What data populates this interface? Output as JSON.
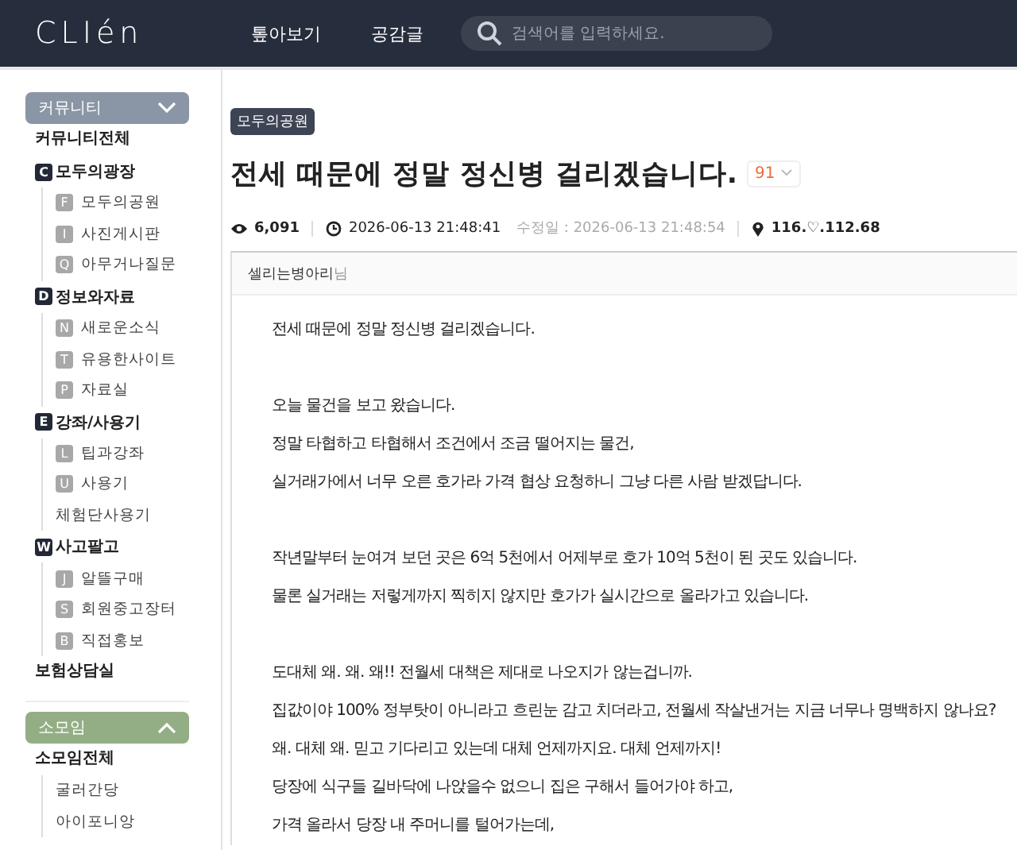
{
  "header": {
    "logo": "CLIén",
    "nav": [
      "톺아보기",
      "공감글"
    ],
    "search": {
      "placeholder": "검색어를 입력하세요."
    }
  },
  "sidebar": {
    "sections": [
      {
        "label": "커뮤니티",
        "expanded": false,
        "color": "#8a96a5",
        "items": [
          {
            "kind": "top",
            "label": "커뮤니티전체"
          },
          {
            "kind": "group",
            "badge": "C",
            "label": "모두의광장",
            "children": [
              {
                "badge": "F",
                "label": "모두의공원"
              },
              {
                "badge": "I",
                "label": "사진게시판"
              },
              {
                "badge": "Q",
                "label": "아무거나질문"
              }
            ]
          },
          {
            "kind": "group",
            "badge": "D",
            "label": "정보와자료",
            "children": [
              {
                "badge": "N",
                "label": "새로운소식"
              },
              {
                "badge": "T",
                "label": "유용한사이트"
              },
              {
                "badge": "P",
                "label": "자료실"
              }
            ]
          },
          {
            "kind": "group",
            "badge": "E",
            "label": "강좌/사용기",
            "children": [
              {
                "badge": "L",
                "label": "팁과강좌"
              },
              {
                "badge": "U",
                "label": "사용기"
              },
              {
                "label": "체험단사용기"
              }
            ]
          },
          {
            "kind": "group",
            "badge": "W",
            "label": "사고팔고",
            "children": [
              {
                "badge": "J",
                "label": "알뜰구매"
              },
              {
                "badge": "S",
                "label": "회원중고장터"
              },
              {
                "badge": "B",
                "label": "직접홍보"
              }
            ]
          },
          {
            "kind": "top",
            "label": "보험상담실"
          }
        ]
      },
      {
        "label": "소모임",
        "expanded": true,
        "color": "#93ae84",
        "items": [
          {
            "kind": "top",
            "label": "소모임전체"
          },
          {
            "kind": "group",
            "children": [
              {
                "label": "굴러간당"
              },
              {
                "label": "아이포니앙"
              }
            ]
          }
        ]
      }
    ]
  },
  "post": {
    "board": "모두의공원",
    "title": "전세 때문에 정말 정신병 걸리겠습니다.",
    "comments": "91",
    "meta": {
      "views": "6,091",
      "posted": "2026-06-13 21:48:41",
      "edited": "수정일 : 2026-06-13 21:48:54",
      "ip": "116.♡.112.68"
    },
    "author": "셀리는병아리",
    "author_suffix": "님",
    "body": [
      [
        "전세 때문에 정말 정신병 걸리겠습니다."
      ],
      [
        "오늘 물건을 보고 왔습니다.",
        "정말 타협하고 타협해서 조건에서 조금 떨어지는 물건,",
        "실거래가에서 너무 오른 호가라 가격 협상 요청하니 그냥 다른 사람 받겠답니다."
      ],
      [
        "작년말부터 눈여겨 보던 곳은 6억 5천에서 어제부로 호가 10억 5천이 된 곳도 있습니다.",
        "물론 실거래는 저렇게까지 찍히지 않지만 호가가 실시간으로 올라가고 있습니다."
      ],
      [
        "도대체 왜. 왜. 왜!!  전월세 대책은 제대로 나오지가 않는겁니까.",
        "집값이야 100% 정부탓이 아니라고 흐린눈 감고 치더라고, 전월세 작살낸거는 지금 너무나 명백하지 않나요?",
        "왜. 대체 왜. 믿고 기다리고 있는데 대체 언제까지요. 대체 언제까지!",
        "당장에 식구들 길바닥에 나앉을수 없으니 집은 구해서 들어가야 하고,",
        "가격 올라서 당장 내 주머니를 털어가는데,"
      ]
    ]
  }
}
